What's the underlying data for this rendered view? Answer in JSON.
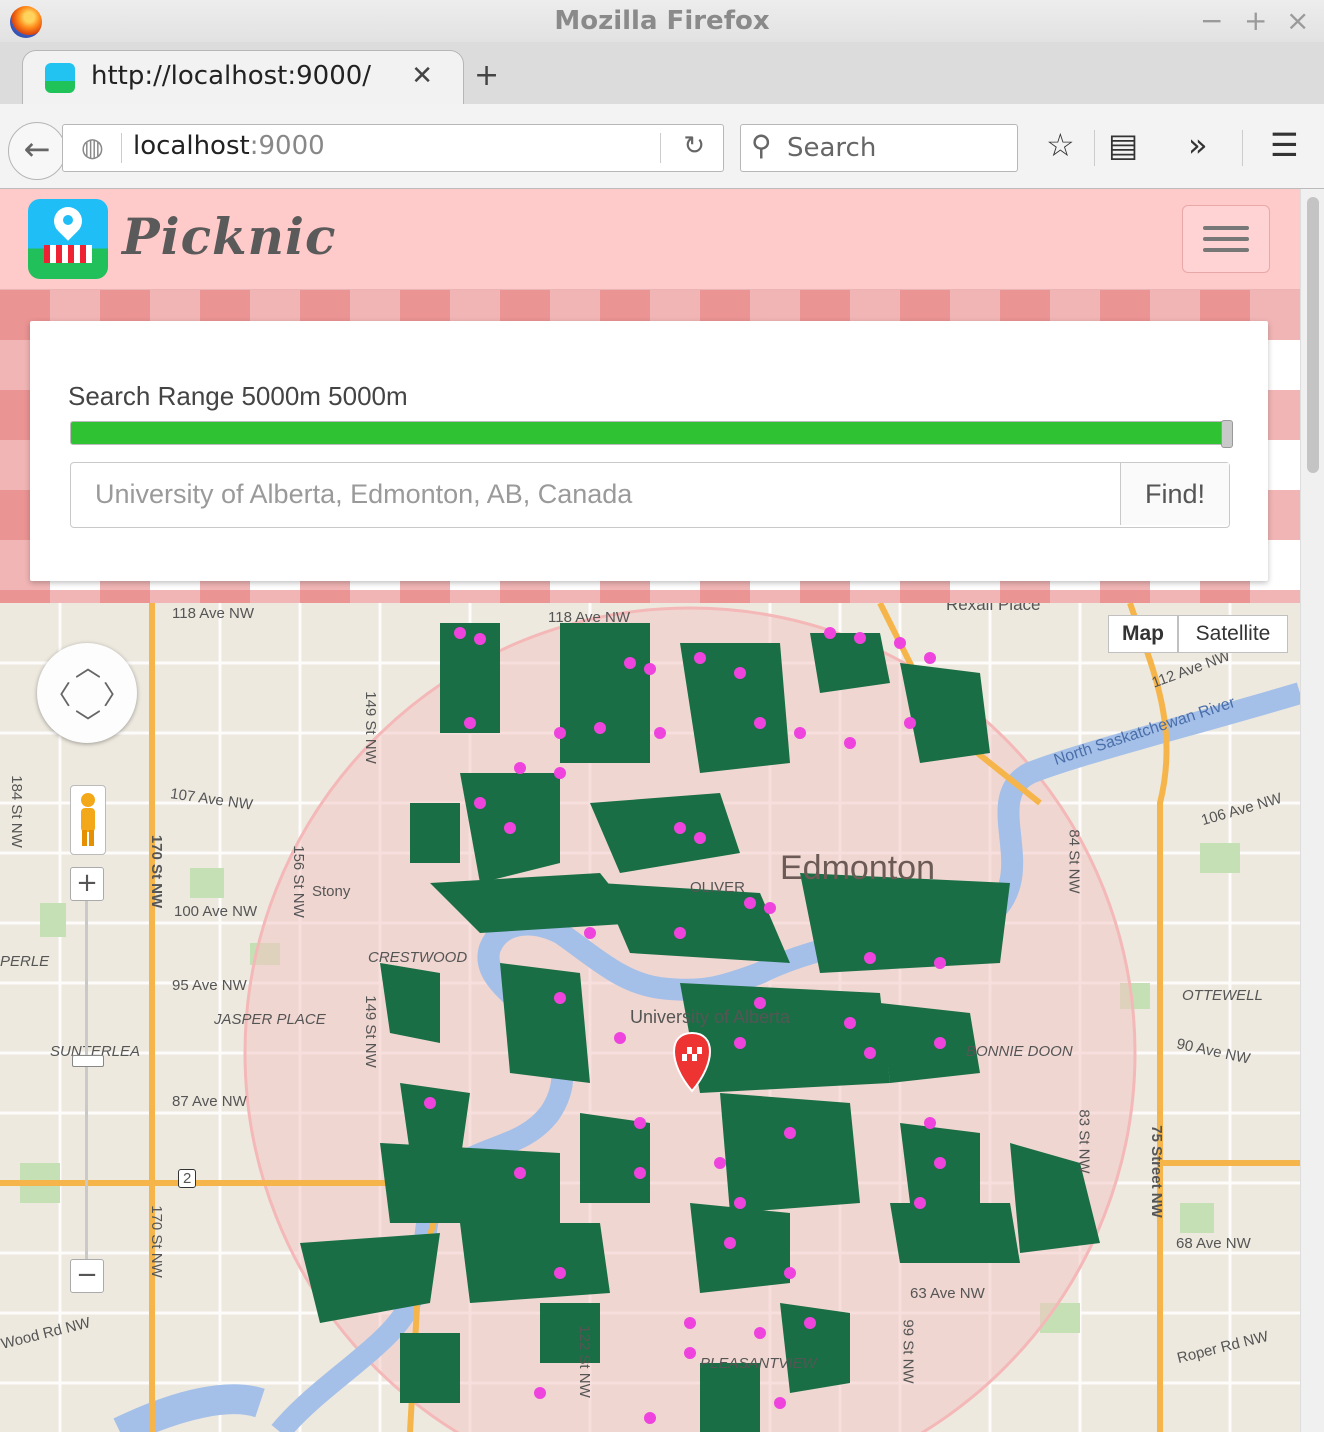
{
  "browser": {
    "window_title": "Mozilla Firefox",
    "tab_title": "http://localhost:9000/",
    "url_host": "localhost",
    "url_port": ":9000",
    "search_placeholder": "Search"
  },
  "app": {
    "brand": "Picknic",
    "search_range_label": "Search Range 5000m 5000m",
    "search_range_fraction": 1.0,
    "location_placeholder": "University of Alberta, Edmonton, AB, Canada",
    "find_button": "Find!"
  },
  "map": {
    "type_map": "Map",
    "type_satellite": "Satellite",
    "labels": {
      "ave118_a": "118 Ave NW",
      "ave118_b": "118 Ave NW",
      "ave107": "107 Ave NW",
      "ave100": "100 Ave NW",
      "ave95": "95 Ave NW",
      "ave87": "87 Ave NW",
      "ave90": "90 Ave NW",
      "ave106": "106 Ave NW",
      "ave68": "68 Ave NW",
      "ave63": "63 Ave NW",
      "ave112": "112 Ave NW",
      "st184": "184 St NW",
      "st170a": "170 St NW",
      "st170b": "170 St NW",
      "st156": "156 St NW",
      "st149a": "149 St NW",
      "st149b": "149 St NW",
      "st122": "122 St NW",
      "st99": "99 St NW",
      "st83": "83 St NW",
      "st84": "84 St NW",
      "st75": "75 Street NW",
      "city": "Edmonton",
      "river": "North Saskatchewan River",
      "crestwood": "CRESTWOOD",
      "jasper_place": "JASPER PLACE",
      "sunterlea": "SUNTERLEA",
      "perle": "PERLE",
      "ottewell": "OTTEWELL",
      "bonnie_doon": "BONNIE DOON",
      "oliver": "OLIVER",
      "pleasantview": "PLEASANTVIEW",
      "hexall": "Rexall Place",
      "stony": "Stony",
      "roper": "Roper Rd NW",
      "wood": "Wood Rd NW",
      "hwy2": "2",
      "university": "University of Alberta"
    },
    "colors": {
      "park": "#1a6e45",
      "picnic_table": "#ee44dd",
      "river": "#a5c0e8",
      "search_circle": "#f4b8b8",
      "highway": "#f6b54a"
    }
  },
  "icons": {
    "firefox_logo": "firefox-logo-icon",
    "back": "back-arrow-icon",
    "globe": "globe-icon",
    "reload": "reload-icon",
    "search": "search-icon",
    "bookmark": "star-icon",
    "reading_list": "reading-list-icon",
    "overflow": "overflow-chevron-icon",
    "menu": "hamburger-menu-icon"
  }
}
